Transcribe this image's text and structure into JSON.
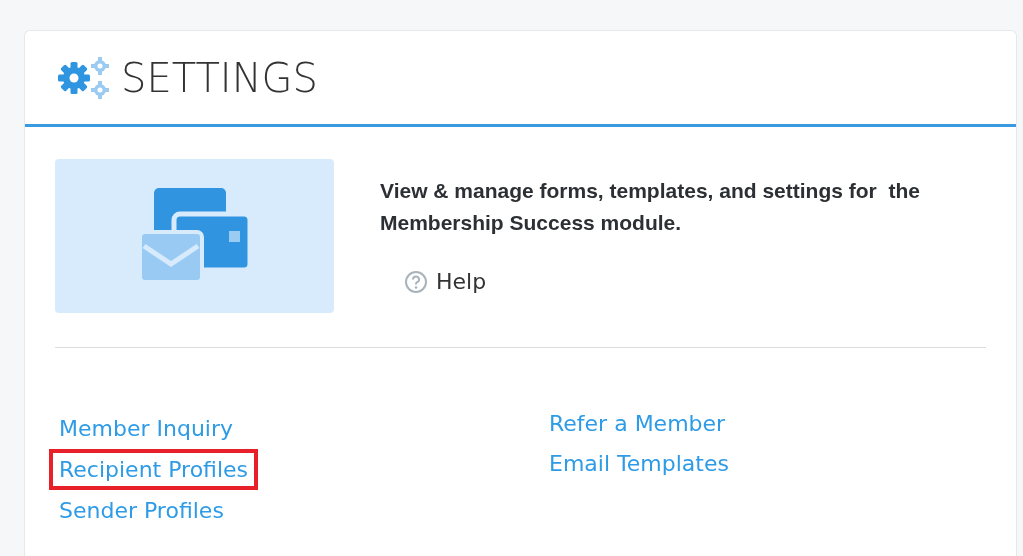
{
  "header": {
    "title": "SETTINGS"
  },
  "intro": {
    "description": "View & manage forms, templates, and settings for  the Membership Success module.",
    "help": "Help"
  },
  "link_columns": [
    [
      {
        "label": "Member Inquiry",
        "highlighted": false
      },
      {
        "label": "Recipient Profiles",
        "highlighted": true
      },
      {
        "label": "Sender Profiles",
        "highlighted": false
      }
    ],
    [
      {
        "label": "Refer a Member",
        "highlighted": false
      },
      {
        "label": "Email Templates",
        "highlighted": false
      }
    ]
  ]
}
